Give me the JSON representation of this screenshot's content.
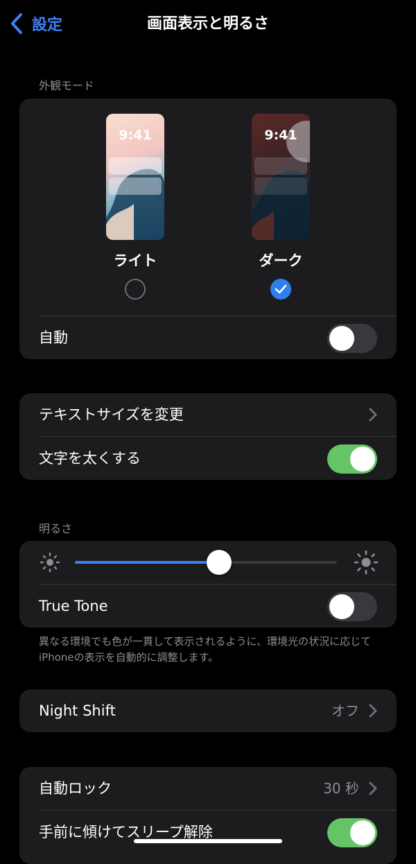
{
  "nav": {
    "back_label": "設定",
    "title": "画面表示と明るさ"
  },
  "appearance": {
    "header": "外観モード",
    "light": {
      "label": "ライト",
      "time": "9:41",
      "selected": false
    },
    "dark": {
      "label": "ダーク",
      "time": "9:41",
      "selected": true
    },
    "auto": {
      "label": "自動",
      "on": false
    }
  },
  "text": {
    "text_size_label": "テキストサイズを変更",
    "bold_text": {
      "label": "文字を太くする",
      "on": true
    }
  },
  "brightness": {
    "header": "明るさ",
    "level": 0.55,
    "true_tone": {
      "label": "True Tone",
      "on": false
    },
    "footnote": "異なる環境でも色が一貫して表示されるように、環境光の状況に応じてiPhoneの表示を自動的に調整します。"
  },
  "night_shift": {
    "label": "Night Shift",
    "value": "オフ"
  },
  "lock": {
    "auto_lock": {
      "label": "自動ロック",
      "value": "30 秒"
    },
    "raise_to_wake": {
      "label": "手前に傾けてスリープ解除",
      "on": true
    }
  },
  "colors": {
    "accent": "#3b82f6",
    "toggle_on": "#65c466",
    "card": "#1c1c1e"
  }
}
